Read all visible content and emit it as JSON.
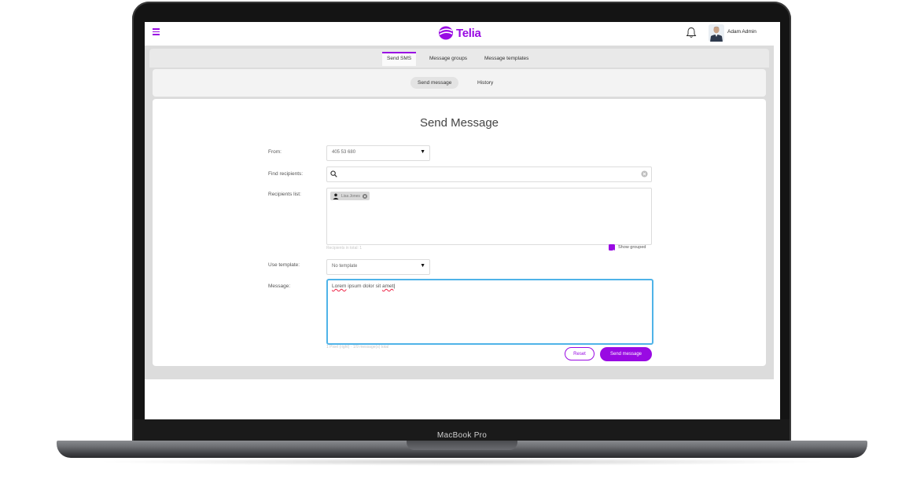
{
  "device": {
    "model_label": "MacBook Pro"
  },
  "header": {
    "brand_name": "Telia",
    "brand_color": "#990ae3",
    "user_name": "Adam Admin",
    "icons": [
      "menu-icon",
      "bell-icon"
    ]
  },
  "tabs": [
    {
      "label": "Send SMS",
      "active": true
    },
    {
      "label": "Message groups",
      "active": false
    },
    {
      "label": "Message templates",
      "active": false
    }
  ],
  "subtabs": [
    {
      "label": "Send message",
      "active": true
    },
    {
      "label": "History",
      "active": false
    }
  ],
  "form": {
    "title": "Send Message",
    "from": {
      "label": "From:",
      "value": "405 53 680"
    },
    "find_recipients": {
      "label": "Find recipients:",
      "value": ""
    },
    "recipients_list": {
      "label": "Recipients list:",
      "chips": [
        "Lisa Jones"
      ],
      "total_text": "Recipients in total: 1",
      "show_grouped_label": "Show grouped",
      "show_grouped_checked": true
    },
    "template": {
      "label": "Use template:",
      "value": "No template"
    },
    "message": {
      "label": "Message:",
      "value_parts": [
        "Lorem",
        " ipsum dolor sit ",
        "amet"
      ],
      "stats_text": "1 Pixel (right) · 1/9 message(s) total"
    },
    "buttons": {
      "reset": "Reset",
      "send": "Send message"
    }
  }
}
